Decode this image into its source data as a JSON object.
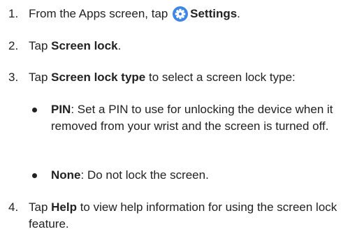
{
  "steps": [
    {
      "number": "1.",
      "pre": "From the Apps screen, tap ",
      "icon": "settings-gear-icon",
      "bold": "Settings",
      "post": "."
    },
    {
      "number": "2.",
      "pre": "Tap ",
      "bold": "Screen lock",
      "post": "."
    },
    {
      "number": "3.",
      "pre": "Tap ",
      "bold": "Screen lock type",
      "post": " to select a screen lock type:",
      "bullets": [
        {
          "bold": "PIN",
          "text": ": Set a PIN to use for unlocking the device when it removed from your wrist and the screen is turned off."
        },
        {
          "bold": "None",
          "text": ": Do not lock the screen."
        }
      ]
    },
    {
      "number": "4.",
      "pre": "Tap ",
      "bold": "Help",
      "post": " to view help information for using the screen lock feature."
    }
  ],
  "colors": {
    "text": "#222222",
    "icon": "#3d85e8"
  }
}
